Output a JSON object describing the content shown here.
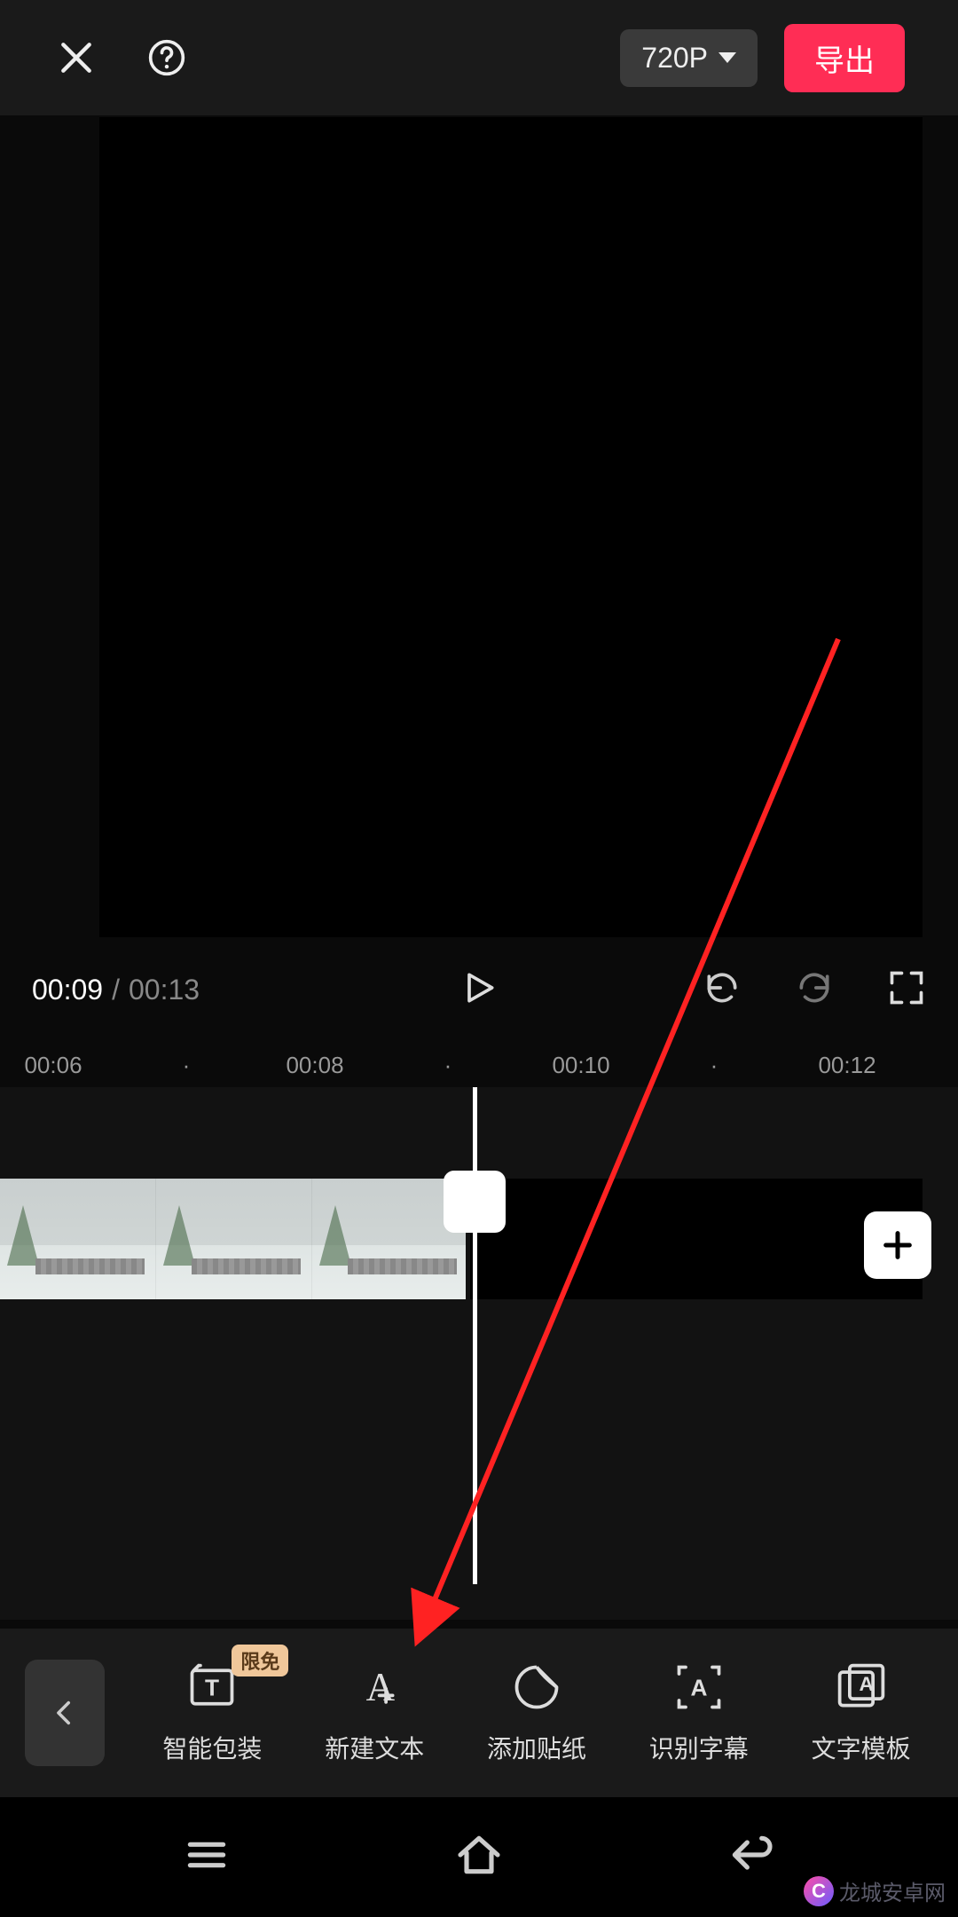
{
  "topbar": {
    "resolution": "720P",
    "export_label": "导出"
  },
  "playback": {
    "current_time": "00:09",
    "separator": "/",
    "total_time": "00:13"
  },
  "ruler": {
    "tick_06": "00:06",
    "tick_08": "00:08",
    "tick_10": "00:10",
    "tick_12": "00:12",
    "dot": "·"
  },
  "toolbar": {
    "badge": "限免",
    "items": [
      {
        "label": "智能包装"
      },
      {
        "label": "新建文本"
      },
      {
        "label": "添加贴纸"
      },
      {
        "label": "识别字幕"
      },
      {
        "label": "文字模板"
      }
    ]
  },
  "watermark": {
    "text": "龙城安卓网"
  }
}
